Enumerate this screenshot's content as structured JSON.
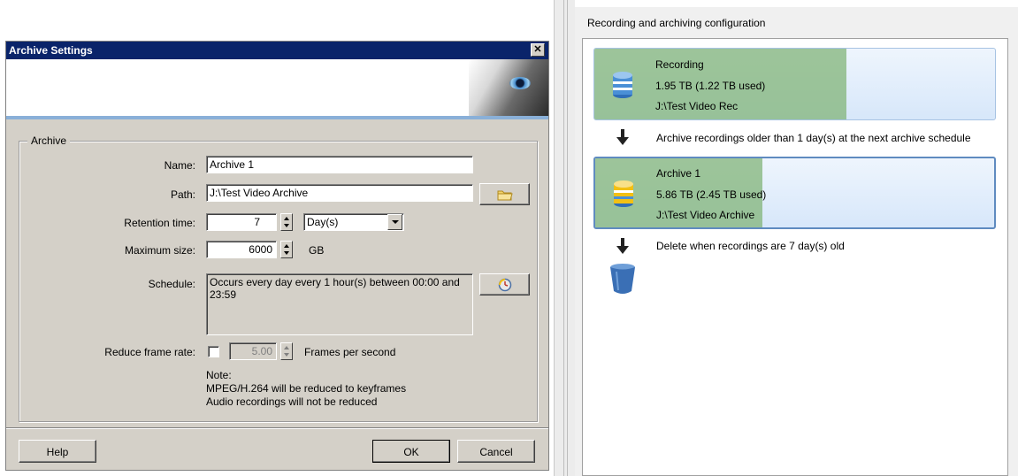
{
  "dialog": {
    "title": "Archive Settings",
    "close_glyph": "✕",
    "group_label": "Archive",
    "name_label": "Name:",
    "name_value": "Archive 1",
    "path_label": "Path:",
    "path_value": "J:\\Test Video Archive",
    "retention_label": "Retention time:",
    "retention_value": "7",
    "retention_unit": "Day(s)",
    "maxsize_label": "Maximum size:",
    "maxsize_value": "6000",
    "maxsize_unit": "GB",
    "schedule_label": "Schedule:",
    "schedule_value": "Occurs every day every 1 hour(s) between 00:00 and 23:59",
    "reduce_label": "Reduce frame rate:",
    "reduce_checked": false,
    "fps_value": "5.00",
    "fps_unit": "Frames per second",
    "note_title": "Note:",
    "note_line1": "MPEG/H.264 will be reduced to keyframes",
    "note_line2": "Audio recordings will not be reduced",
    "help_button": "Help",
    "ok_button": "OK",
    "cancel_button": "Cancel",
    "icons": [
      "close-icon",
      "folder-icon",
      "schedule-clock-icon",
      "spin-arrows-icon",
      "dropdown-arrow-icon"
    ]
  },
  "config": {
    "title": "Recording and archiving configuration",
    "recording": {
      "name": "Recording",
      "size": "1.95 TB (1.22 TB used)",
      "path": "J:\\Test Video Rec",
      "used_fraction": 0.63
    },
    "archive_note": "Archive recordings older than 1 day(s) at the next archive schedule",
    "archive": {
      "name": "Archive 1",
      "size": "5.86 TB (2.45 TB used)",
      "path": "J:\\Test Video Archive",
      "used_fraction": 0.42
    },
    "delete_note": "Delete when recordings are 7 day(s) old",
    "colors": {
      "recording_db": "#4a8fd6",
      "archive_db": "#f2c014",
      "used_fill": "#82b478",
      "trash": "#3a6fb5"
    }
  }
}
